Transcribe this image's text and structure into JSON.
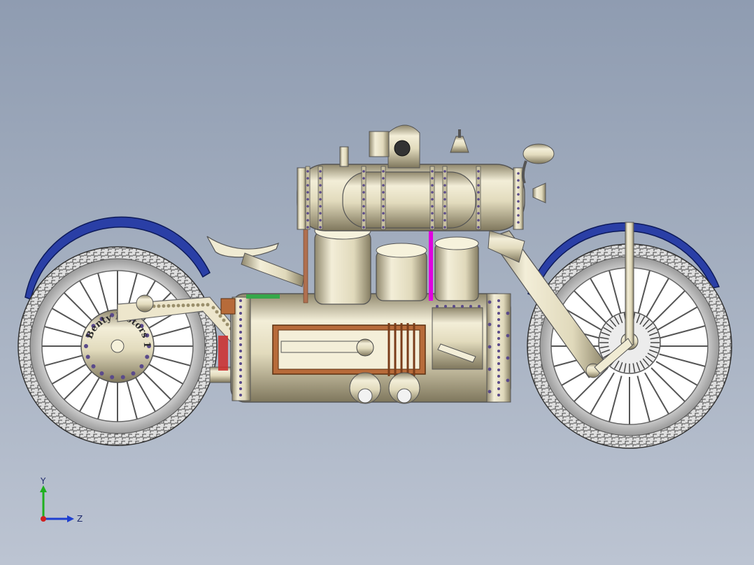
{
  "model": {
    "wheel_inscription": "Benty Motors 1882",
    "colors": {
      "background_top": "#8f9cb1",
      "background_bottom": "#bcc4d2",
      "metal": "#e6e0c6",
      "metal_shadow": "#9c9479",
      "tire": "#d8d8d8",
      "fender": "#2a3fa6",
      "copper": "#b76b3a",
      "magenta_pipe": "#e000e0",
      "bolt": "#5a4a8a"
    }
  },
  "triad": {
    "y_label": "Y",
    "z_label": "Z",
    "colors": {
      "y": "#1fb01f",
      "z": "#1e3fd0",
      "x": "#d02020"
    }
  }
}
